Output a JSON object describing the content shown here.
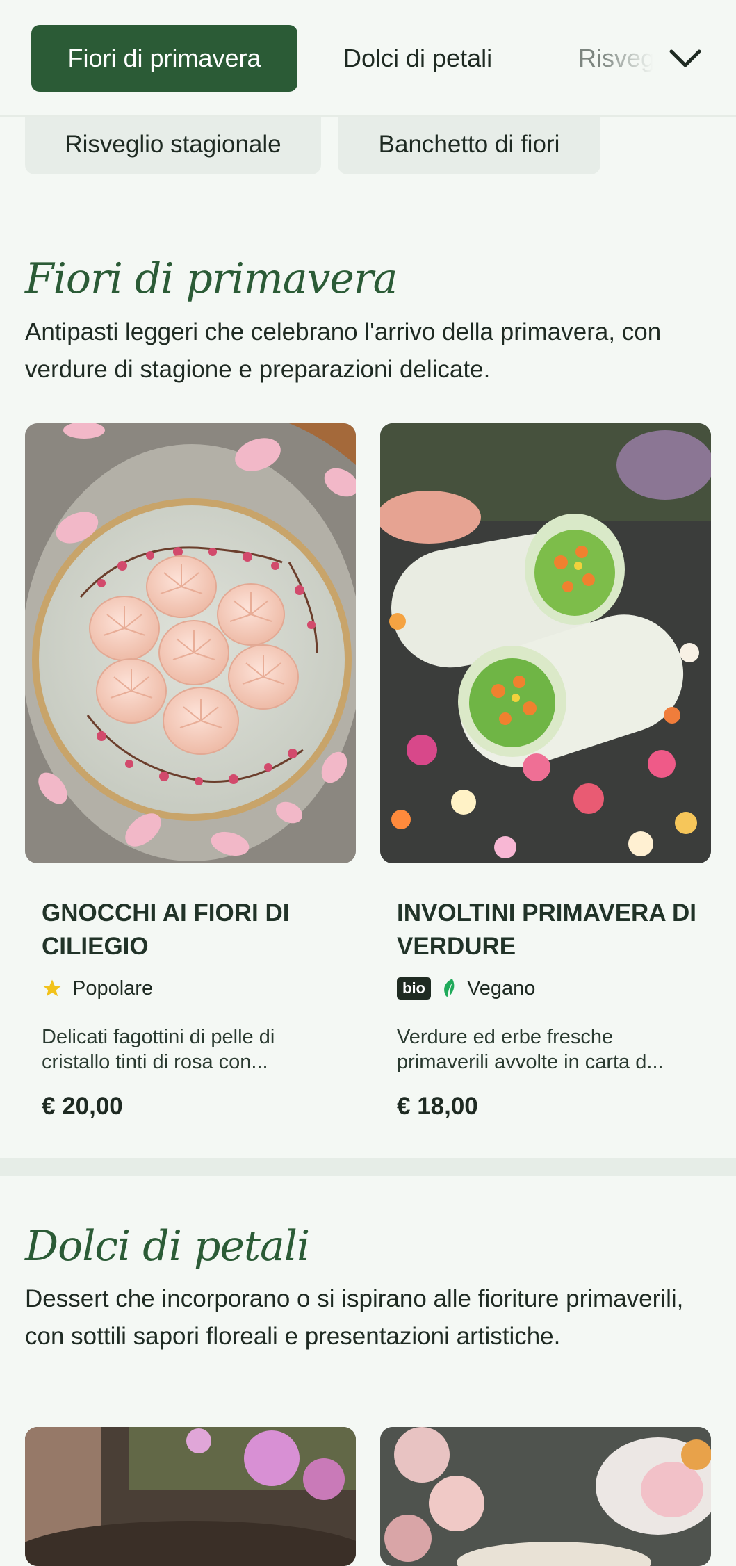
{
  "nav": {
    "tabs": [
      {
        "label": "Fiori di primavera",
        "active": true
      },
      {
        "label": "Dolci di petali",
        "active": false
      },
      {
        "label": "Risveglio stagionale",
        "active": false
      }
    ],
    "more_icon": "chevron-down-icon"
  },
  "chips": [
    {
      "label": "Risveglio stagionale"
    },
    {
      "label": "Banchetto di fiori"
    }
  ],
  "sections": [
    {
      "title": "Fiori di primavera",
      "description": "Antipasti leggeri che celebrano l'arrivo della primavera, con verdure di stagione e preparazioni delicate.",
      "cards": [
        {
          "title": "GNOCCHI AI FIORI DI CILIEGIO",
          "tag_icon": "star-icon",
          "tag": "Popolare",
          "description": "Delicati fagottini di pelle di cristallo tinti di rosa con...",
          "price": "€ 20,00"
        },
        {
          "title": "INVOLTINI PRIMAVERA DI VERDURE",
          "badge": "bio",
          "tag_icon": "leaf-icon",
          "tag": "Vegano",
          "description": "Verdure ed erbe fresche primaverili avvolte in carta d...",
          "price": "€ 18,00"
        }
      ]
    },
    {
      "title": "Dolci di petali",
      "description": "Dessert che incorporano o si ispirano alle fioriture primaverili, con sottili sapori floreali e presentazioni artistiche."
    }
  ],
  "colors": {
    "accent": "#2b5b36",
    "background": "#f4f8f4",
    "chip": "#e7ede8",
    "star": "#f2c21b",
    "leaf": "#1faa5a"
  }
}
